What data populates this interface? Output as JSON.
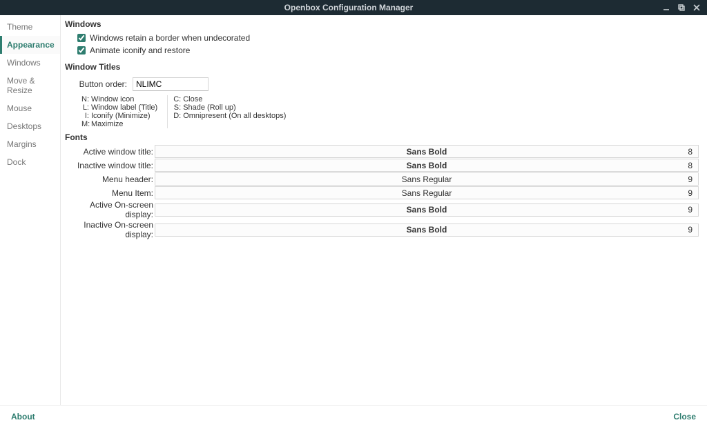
{
  "window": {
    "title": "Openbox Configuration Manager"
  },
  "sidebar": {
    "items": [
      {
        "label": "Theme"
      },
      {
        "label": "Appearance"
      },
      {
        "label": "Windows"
      },
      {
        "label": "Move & Resize"
      },
      {
        "label": "Mouse"
      },
      {
        "label": "Desktops"
      },
      {
        "label": "Margins"
      },
      {
        "label": "Dock"
      }
    ],
    "active_index": 1
  },
  "sections": {
    "windows_heading": "Windows",
    "retain_border_label": "Windows retain a border when undecorated",
    "retain_border_checked": true,
    "animate_iconify_label": "Animate iconify and restore",
    "animate_iconify_checked": true,
    "window_titles_heading": "Window Titles",
    "button_order_label": "Button order:",
    "button_order_value": "NLIMC",
    "legend": {
      "left": [
        {
          "code": "N:",
          "desc": "Window icon"
        },
        {
          "code": "L:",
          "desc": "Window label (Title)"
        },
        {
          "code": "I:",
          "desc": "Iconify (Minimize)"
        },
        {
          "code": "M:",
          "desc": "Maximize"
        }
      ],
      "right": [
        {
          "code": "C:",
          "desc": "Close"
        },
        {
          "code": "S:",
          "desc": "Shade (Roll up)"
        },
        {
          "code": "D:",
          "desc": "Omnipresent (On all desktops)"
        }
      ]
    },
    "fonts_heading": "Fonts",
    "fonts": [
      {
        "label": "Active window title:",
        "name": "Sans Bold",
        "size": "8",
        "bold": true
      },
      {
        "label": "Inactive window title:",
        "name": "Sans Bold",
        "size": "8",
        "bold": true
      },
      {
        "label": "Menu header:",
        "name": "Sans Regular",
        "size": "9",
        "bold": false
      },
      {
        "label": "Menu Item:",
        "name": "Sans Regular",
        "size": "9",
        "bold": false
      },
      {
        "label": "Active On-screen display:",
        "name": "Sans Bold",
        "size": "9",
        "bold": true
      },
      {
        "label": "Inactive On-screen display:",
        "name": "Sans Bold",
        "size": "9",
        "bold": true
      }
    ]
  },
  "footer": {
    "about": "About",
    "close": "Close"
  }
}
